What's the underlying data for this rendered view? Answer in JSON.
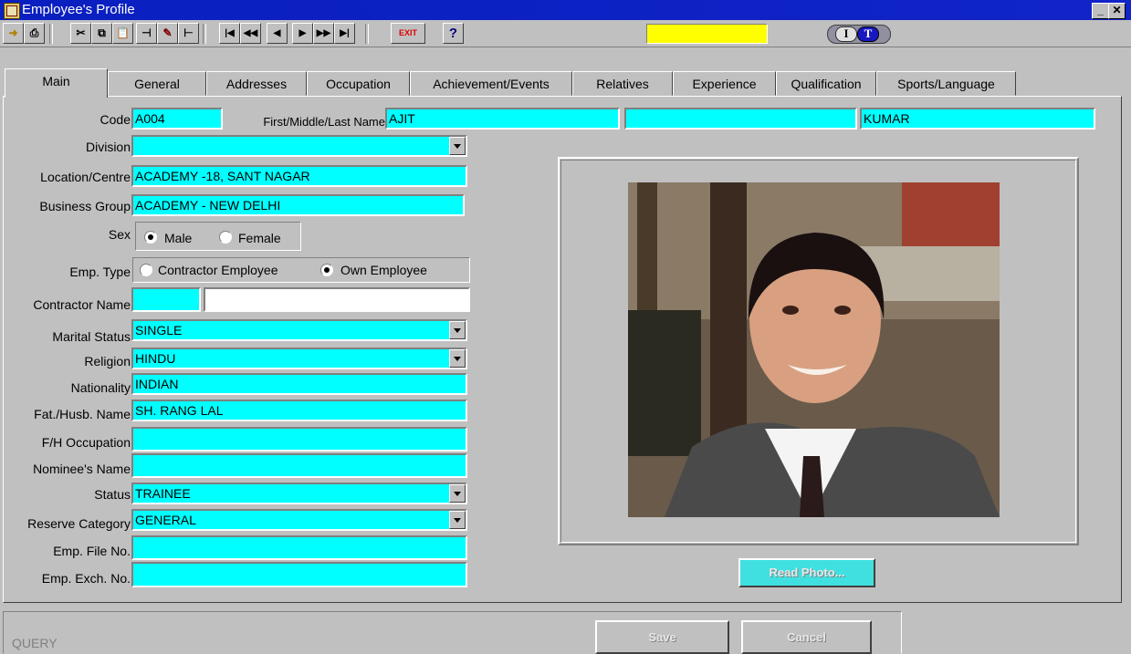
{
  "window": {
    "title": "Employee's Profile"
  },
  "toolbar": {
    "exit_label": "EXIT",
    "help_label": "?",
    "badge_i": "I",
    "badge_t": "T",
    "indicator_color": "#ffff00"
  },
  "tabs": [
    {
      "label": "Main",
      "active": true
    },
    {
      "label": "General"
    },
    {
      "label": "Addresses"
    },
    {
      "label": "Occupation"
    },
    {
      "label": "Achievement/Events"
    },
    {
      "label": "Relatives"
    },
    {
      "label": "Experience"
    },
    {
      "label": "Qualification"
    },
    {
      "label": "Sports/Language"
    }
  ],
  "form": {
    "code_label": "Code",
    "code": "A004",
    "name_label": "First/Middle/Last Name",
    "first_name": "AJIT",
    "middle_name": "",
    "last_name": "KUMAR",
    "division_label": "Division",
    "division": "",
    "location_label": "Location/Centre",
    "location": "ACADEMY -18, SANT NAGAR",
    "business_group_label": "Business Group",
    "business_group": "ACADEMY - NEW DELHI",
    "sex_label": "Sex",
    "sex_male": "Male",
    "sex_female": "Female",
    "emp_type_label": "Emp. Type",
    "emp_type_contractor": "Contractor Employee",
    "emp_type_own": "Own Employee",
    "contractor_name_label": "Contractor Name",
    "contractor_code": "",
    "contractor_name": "",
    "marital_status_label": "Marital Status",
    "marital_status": "SINGLE",
    "religion_label": "Religion",
    "religion": "HINDU",
    "nationality_label": "Nationality",
    "nationality": "INDIAN",
    "fat_husb_label": "Fat./Husb. Name",
    "fat_husb_name": "SH. RANG LAL",
    "fh_occupation_label": "F/H Occupation",
    "fh_occupation": "",
    "nominee_label": "Nominee's Name",
    "nominee": "",
    "status_label": "Status",
    "status": "TRAINEE",
    "reserve_label": "Reserve Category",
    "reserve": "GENERAL",
    "file_no_label": "Emp. File No.",
    "file_no": "",
    "exch_no_label": "Emp. Exch. No.",
    "exch_no": ""
  },
  "photo": {
    "read_label": "Read Photo..."
  },
  "footer": {
    "mode": "QUERY",
    "save_label": "Save",
    "cancel_label": "Cancel"
  },
  "colors": {
    "field": "#00ffff",
    "titlebar": "#0a1fbf",
    "face": "#c0c0c0"
  }
}
